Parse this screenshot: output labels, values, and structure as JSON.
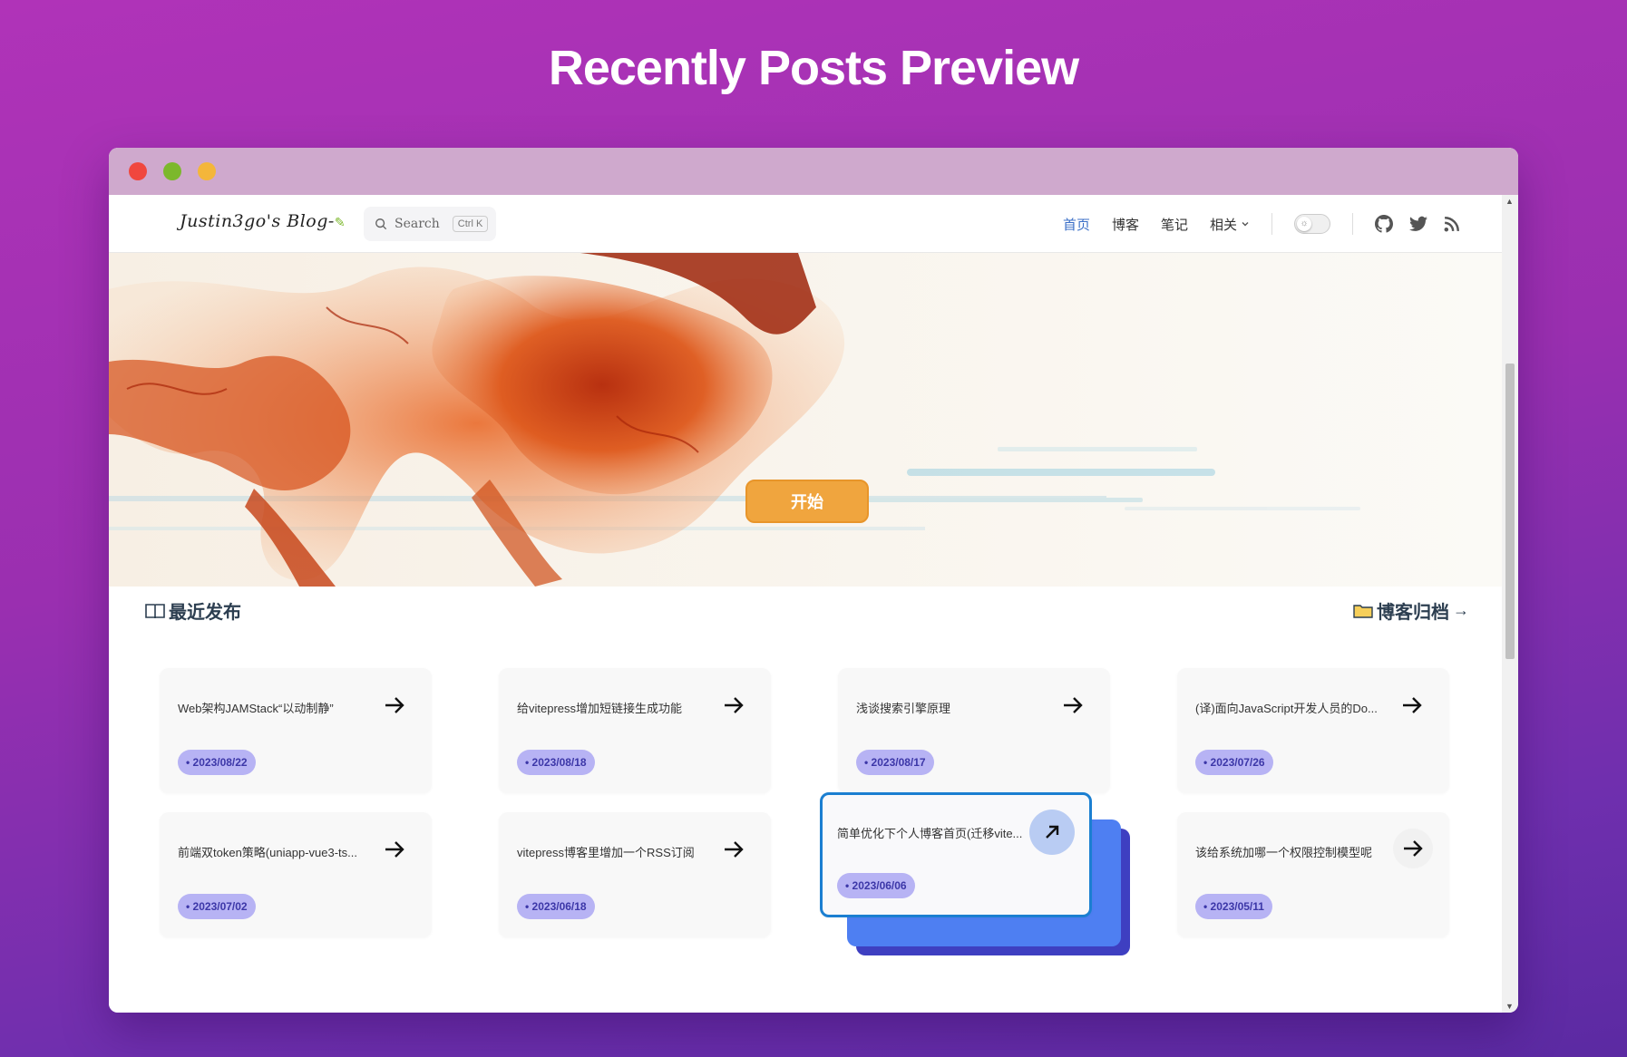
{
  "headline": "Recently Posts Preview",
  "window": {
    "traffic_lights": [
      "#f0473e",
      "#7cb82c",
      "#f4b63a"
    ]
  },
  "navbar": {
    "logo": "Justin3go's Blog-",
    "search_placeholder": "Search",
    "search_shortcut": "Ctrl K",
    "links": [
      "首页",
      "博客",
      "笔记",
      "相关"
    ],
    "icons": [
      "theme-toggle-icon",
      "github-icon",
      "twitter-icon",
      "rss-icon"
    ]
  },
  "hero": {
    "button_label": "开始"
  },
  "section": {
    "title": "最近发布",
    "archive_label": "博客归档",
    "archive_arrow": "→"
  },
  "posts": [
    {
      "title": "Web架构JAMStack“以动制静”",
      "date": "2023/08/22"
    },
    {
      "title": "给vitepress增加短链接生成功能",
      "date": "2023/08/18"
    },
    {
      "title": "浅谈搜索引擎原理",
      "date": "2023/08/17"
    },
    {
      "title": "(译)面向JavaScript开发人员的Do...",
      "date": "2023/07/26"
    },
    {
      "title": "前端双token策略(uniapp-vue3-ts...",
      "date": "2023/07/02"
    },
    {
      "title": "vitepress博客里增加一个RSS订阅",
      "date": "2023/06/18"
    },
    {
      "title": "简单优化下个人博客首页(迁移vite...",
      "date": "2023/06/06"
    },
    {
      "title": "该给系统加哪一个权限控制模型呢",
      "date": "2023/05/11"
    }
  ],
  "colors": {
    "date_badge_bg": "#b7b3f4",
    "date_badge_text": "#3c37a8",
    "highlight_border": "#1b7fd1",
    "start_button": "#f0a53e"
  }
}
